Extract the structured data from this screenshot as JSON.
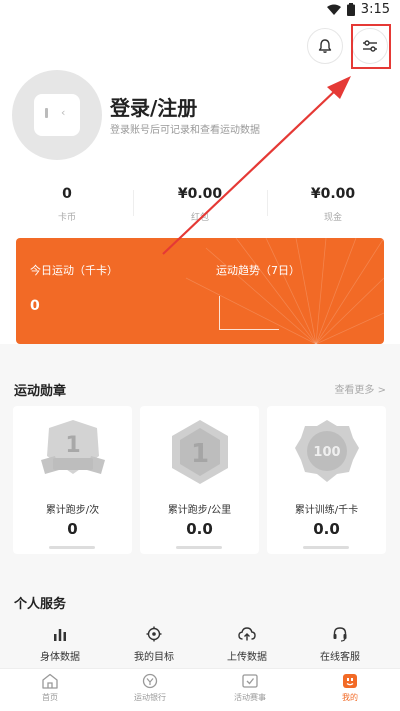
{
  "status_bar": {
    "time": "3:15"
  },
  "profile": {
    "title": "登录/注册",
    "subtitle": "登录账号后可记录和查看运动数据"
  },
  "stats": [
    {
      "value": "0",
      "label": "卡币"
    },
    {
      "value": "¥0.00",
      "label": "红包"
    },
    {
      "value": "¥0.00",
      "label": "现金"
    }
  ],
  "sport_card": {
    "today_label": "今日运动（千卡）",
    "today_value": "0",
    "trend_label": "运动趋势（7日）",
    "color": "#f26a26"
  },
  "medals": {
    "title": "运动勋章",
    "see_more": "查看更多 >",
    "items": [
      {
        "label": "累计跑步/次",
        "value": "0",
        "icon": "medal-ribbon-1-icon"
      },
      {
        "label": "累计跑步/公里",
        "value": "0.0",
        "icon": "medal-hexagon-1-icon"
      },
      {
        "label": "累计训练/千卡",
        "value": "0.0",
        "icon": "medal-badge-100-icon"
      }
    ]
  },
  "services": {
    "title": "个人服务",
    "items": [
      {
        "label": "身体数据",
        "icon": "bar-chart-icon"
      },
      {
        "label": "我的目标",
        "icon": "target-icon"
      },
      {
        "label": "上传数据",
        "icon": "upload-cloud-icon"
      },
      {
        "label": "在线客服",
        "icon": "headset-icon"
      }
    ]
  },
  "tabs": [
    {
      "label": "首页",
      "icon": "home-icon",
      "active": false
    },
    {
      "label": "运动银行",
      "icon": "bank-icon",
      "active": false
    },
    {
      "label": "活动赛事",
      "icon": "event-icon",
      "active": false
    },
    {
      "label": "我的",
      "icon": "profile-icon",
      "active": true
    }
  ],
  "colors": {
    "accent": "#f26a26",
    "annotation": "#e53935"
  }
}
